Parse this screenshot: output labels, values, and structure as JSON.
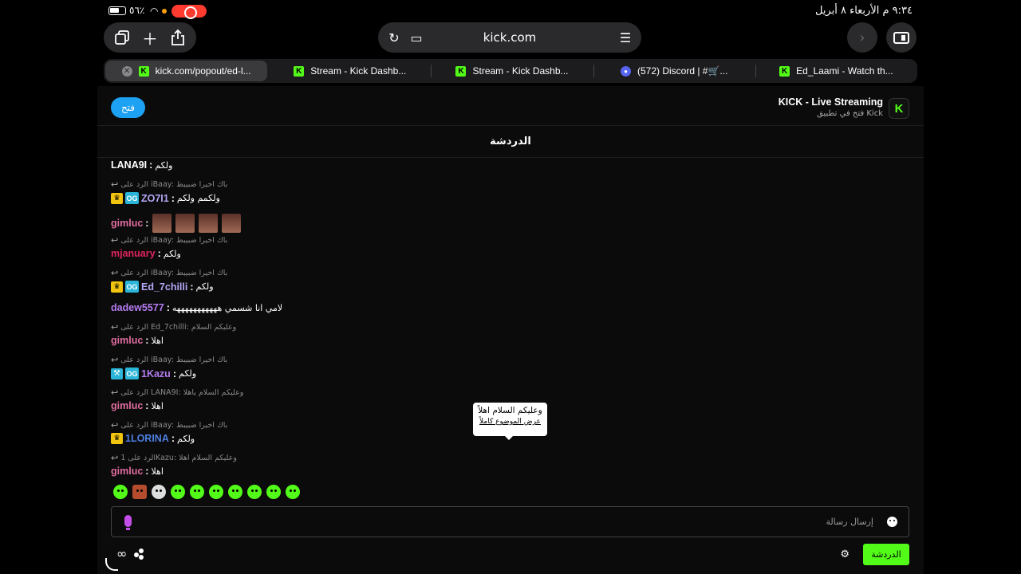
{
  "status_bar": {
    "time": "٩:٣٤ م  الأربعاء ٨ أبريل",
    "battery_pct": "٥٦٪"
  },
  "browser": {
    "url": "kick.com",
    "tabs": [
      {
        "label": "kick.com/popout/ed-l...",
        "icon": "kick"
      },
      {
        "label": "Stream - Kick Dashb...",
        "icon": "kick"
      },
      {
        "label": "Stream - Kick Dashb...",
        "icon": "kick"
      },
      {
        "label": "(572) Discord | #🛒...",
        "icon": "discord"
      },
      {
        "label": "Ed_Laami - Watch th...",
        "icon": "kick"
      }
    ]
  },
  "banner": {
    "open_label": "فتح",
    "app_title": "KICK - Live Streaming",
    "app_subtitle": "فتح في تطبيق Kick",
    "logo_letter": "K"
  },
  "chat": {
    "header": "الدردشة",
    "messages": [
      {
        "type": "msg",
        "user": "LANA9I",
        "color": "#ffffff",
        "text": "ولكم"
      },
      {
        "type": "reply",
        "text": "الرد على iBaay: باك اخيرا ضبيبط"
      },
      {
        "type": "msg",
        "user": "ZO7I1",
        "color": "#b4a7f5",
        "text": "ولكمم ولكم",
        "badges": [
          "crown",
          "og"
        ]
      },
      {
        "type": "msg",
        "user": "gimluc",
        "color": "#e06c9f",
        "text": "",
        "emotes": 4
      },
      {
        "type": "reply",
        "text": "الرد على iBaay: باك اخيرا ضبيبط"
      },
      {
        "type": "msg",
        "user": "mjanuary",
        "color": "#e0245e",
        "text": "ولكم"
      },
      {
        "type": "reply",
        "text": "الرد على iBaay: باك اخيرا ضبيبط"
      },
      {
        "type": "msg",
        "user": "Ed_7chilli",
        "color": "#b4a7f5",
        "text": "ولكم",
        "badges": [
          "crown",
          "og"
        ]
      },
      {
        "type": "msg",
        "user": "dadew5577",
        "color": "#b47cf0",
        "text": "لامي انا شسمي هههههههههههه"
      },
      {
        "type": "reply",
        "text": "الرد على Ed_7chilli: وعليكم السلام"
      },
      {
        "type": "msg",
        "user": "gimluc",
        "color": "#e06c9f",
        "text": "اهلا"
      },
      {
        "type": "reply",
        "text": "الرد على iBaay: باك اخيرا ضبيبط"
      },
      {
        "type": "msg",
        "user": "1Kazu",
        "color": "#b47cf0",
        "text": "ولكم",
        "badges": [
          "hammer",
          "og"
        ]
      },
      {
        "type": "reply",
        "text": "الرد على LANA9I: وعليكم السلام ياهلا"
      },
      {
        "type": "msg",
        "user": "gimluc",
        "color": "#e06c9f",
        "text": "اهلا"
      },
      {
        "type": "reply",
        "text": "الرد على iBaay: باك اخيرا ضبيبط"
      },
      {
        "type": "msg",
        "user": "1LORINA",
        "color": "#4e7fe0",
        "text": "ولكم",
        "badges": [
          "crown"
        ]
      },
      {
        "type": "reply",
        "text": "الرد على 1Kazu: وعليكم السلام اهلا"
      },
      {
        "type": "msg",
        "user": "gimluc",
        "color": "#e06c9f",
        "text": "اهلا"
      }
    ],
    "tooltip": {
      "text": "وعليكم السلام اهلاً",
      "link": "عرض الموضوع كاملاً"
    },
    "input_placeholder": "إرسال رسالة",
    "send_label": "الدردشة"
  },
  "colors": {
    "kick_green": "#53fc18",
    "open_blue": "#1da1f2"
  }
}
